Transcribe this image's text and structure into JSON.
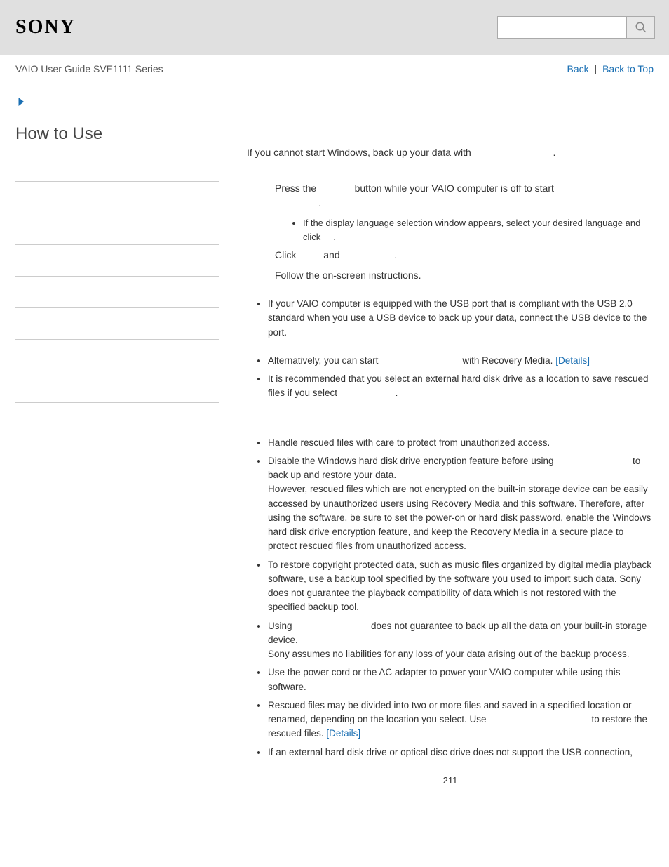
{
  "header": {
    "logo": "SONY",
    "search_placeholder": ""
  },
  "breadcrumb": {
    "title": "VAIO User Guide SVE1111 Series",
    "back": "Back",
    "separator": "|",
    "back_to_top": "Back to Top"
  },
  "sidebar": {
    "title": "How to Use"
  },
  "main": {
    "intro": "If you cannot start Windows, back up your data with",
    "intro_end": ".",
    "step1_a": "Press the",
    "step1_b": "button while your VAIO computer is off to start",
    "step1_c": ".",
    "sub1": "If the display language selection window appears, select your desired language and click",
    "sub1_end": ".",
    "step2_a": "Click",
    "step2_b": "and",
    "step2_end": ".",
    "step3": "Follow the on-screen instructions.",
    "bullets_a": [
      "If your VAIO computer is equipped with the USB port that is compliant with the USB 2.0 standard when you use a USB device to back up your data, connect the USB device to the port."
    ],
    "alt_a": "Alternatively, you can start",
    "alt_b": "with Recovery Media.",
    "details": "[Details]",
    "alt2_a": "It is recommended that you select an external hard disk drive as a location to save rescued files if you select",
    "alt2_end": ".",
    "notes": {
      "n1": "Handle rescued files with care to protect from unauthorized access.",
      "n2_a": "Disable the Windows hard disk drive encryption feature before using",
      "n2_b": "to back up and restore your data.",
      "n2_c": "However, rescued files which are not encrypted on the built-in storage device can be easily accessed by unauthorized users using Recovery Media and this software. Therefore, after using the software, be sure to set the power-on or hard disk password, enable the Windows hard disk drive encryption feature, and keep the Recovery Media in a secure place to protect rescued files from unauthorized access.",
      "n3": "To restore copyright protected data, such as music files organized by digital media playback software, use a backup tool specified by the software you used to import such data. Sony does not guarantee the playback compatibility of data which is not restored with the specified backup tool.",
      "n4_a": "Using",
      "n4_b": "does not guarantee to back up all the data on your built-in storage device.",
      "n4_c": "Sony assumes no liabilities for any loss of your data arising out of the backup process.",
      "n5": "Use the power cord or the AC adapter to power your VAIO computer while using this software.",
      "n6_a": "Rescued files may be divided into two or more files and saved in a specified location or renamed, depending on the location you select. Use",
      "n6_b": "to restore the rescued files.",
      "n7": "If an external hard disk drive or optical disc drive does not support the USB connection,"
    }
  },
  "page_number": "211"
}
